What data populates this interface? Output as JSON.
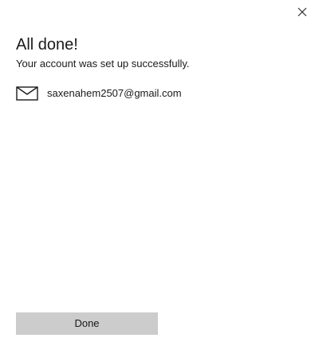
{
  "dialog": {
    "title": "All done!",
    "message": "Your account was set up successfully.",
    "account": {
      "icon": "mail-envelope-icon",
      "email": "saxenahem2507@gmail.com"
    },
    "done_label": "Done",
    "close_icon": "close-icon"
  },
  "colors": {
    "background": "#ffffff",
    "text": "#1a1a1a",
    "button_bg": "#cccccc"
  }
}
